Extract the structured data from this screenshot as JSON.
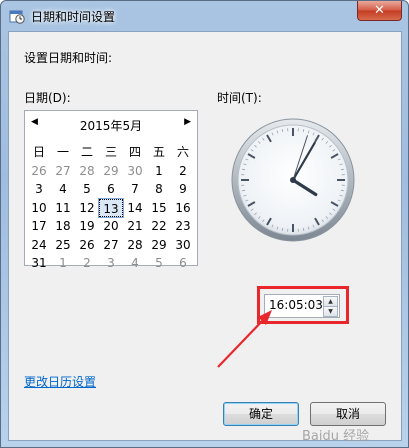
{
  "window": {
    "title": "日期和时间设置",
    "close_label": "✕"
  },
  "heading": "设置日期和时间:",
  "date_label": "日期(D):",
  "time_label": "时间(T):",
  "calendar": {
    "title": "2015年5月",
    "prev_icon": "left-triangle-icon",
    "next_icon": "right-triangle-icon",
    "weekdays": [
      "日",
      "一",
      "二",
      "三",
      "四",
      "五",
      "六"
    ],
    "weeks": [
      [
        {
          "d": "26",
          "o": true
        },
        {
          "d": "27",
          "o": true
        },
        {
          "d": "28",
          "o": true
        },
        {
          "d": "29",
          "o": true
        },
        {
          "d": "30",
          "o": true
        },
        {
          "d": "1"
        },
        {
          "d": "2"
        }
      ],
      [
        {
          "d": "3"
        },
        {
          "d": "4"
        },
        {
          "d": "5"
        },
        {
          "d": "6"
        },
        {
          "d": "7"
        },
        {
          "d": "8"
        },
        {
          "d": "9"
        }
      ],
      [
        {
          "d": "10"
        },
        {
          "d": "11"
        },
        {
          "d": "12"
        },
        {
          "d": "13",
          "sel": true
        },
        {
          "d": "14"
        },
        {
          "d": "15"
        },
        {
          "d": "16"
        }
      ],
      [
        {
          "d": "17"
        },
        {
          "d": "18"
        },
        {
          "d": "19"
        },
        {
          "d": "20"
        },
        {
          "d": "21"
        },
        {
          "d": "22"
        },
        {
          "d": "23"
        }
      ],
      [
        {
          "d": "24"
        },
        {
          "d": "25"
        },
        {
          "d": "26"
        },
        {
          "d": "27"
        },
        {
          "d": "28"
        },
        {
          "d": "29"
        },
        {
          "d": "30"
        }
      ],
      [
        {
          "d": "31"
        },
        {
          "d": "1",
          "o": true
        },
        {
          "d": "2",
          "o": true
        },
        {
          "d": "3",
          "o": true
        },
        {
          "d": "4",
          "o": true
        },
        {
          "d": "5",
          "o": true
        },
        {
          "d": "6",
          "o": true
        }
      ]
    ]
  },
  "clock": {
    "hour": 16,
    "minute": 5,
    "second": 3
  },
  "time_value": "16:05:03",
  "change_calendar_link": "更改日历设置",
  "buttons": {
    "ok": "确定",
    "cancel": "取消"
  },
  "watermark": "Baidu 经验",
  "colors": {
    "highlight": "#e8262b",
    "link": "#0066cc"
  }
}
